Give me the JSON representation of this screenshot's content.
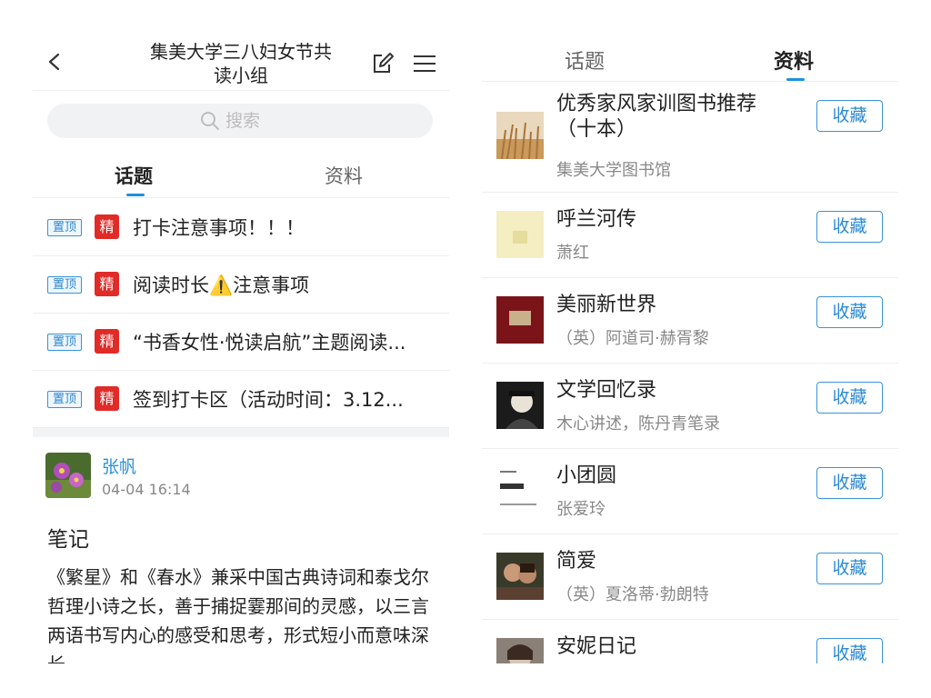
{
  "left": {
    "header": {
      "title": "集美大学三八妇女节共读小组"
    },
    "search": {
      "placeholder": "搜索"
    },
    "tabs": [
      {
        "label": "话题",
        "active": true
      },
      {
        "label": "资料",
        "active": false
      }
    ],
    "pinned": [
      {
        "badge": "置顶",
        "tag": "精",
        "title": "打卡注意事项！！！"
      },
      {
        "badge": "置顶",
        "tag": "精",
        "title": "阅读时长⚠️注意事项"
      },
      {
        "badge": "置顶",
        "tag": "精",
        "title": "“书香女性·悦读启航”主题阅读..."
      },
      {
        "badge": "置顶",
        "tag": "精",
        "title": "签到打卡区（活动时间：3.12..."
      }
    ],
    "post": {
      "author": "张帆",
      "time": "04-04 16:14",
      "title": "笔记",
      "body": "《繁星》和《春水》兼采中国古典诗词和泰戈尔哲理小诗之长，善于捕捉霎那间的灵感，以三言两语书写内心的感受和思考，形式短小而意味深长。"
    }
  },
  "right": {
    "tabs": [
      {
        "label": "话题",
        "active": false
      },
      {
        "label": "资料",
        "active": true
      }
    ],
    "books": [
      {
        "title": "优秀家风家训图书推荐（十本）",
        "author": "集美大学图书馆",
        "button": "收藏",
        "cover": "wheat-field"
      },
      {
        "title": "呼兰河传",
        "author": "萧红",
        "button": "收藏",
        "cover": "plain-yellow"
      },
      {
        "title": "美丽新世界",
        "author": "（英）阿道司·赫胥黎",
        "button": "收藏",
        "cover": "dark-red"
      },
      {
        "title": "文学回忆录",
        "author": "木心讲述，陈丹青笔录",
        "button": "收藏",
        "cover": "portrait-bw"
      },
      {
        "title": "小团圆",
        "author": "张爱玲",
        "button": "收藏",
        "cover": "white-text"
      },
      {
        "title": "简爱",
        "author": "（英）夏洛蒂·勃朗特",
        "button": "收藏",
        "cover": "film-still"
      },
      {
        "title": "安妮日记",
        "author": "",
        "button": "收藏",
        "cover": "photo-girl"
      }
    ]
  },
  "colors": {
    "accent": "#1e8fe1",
    "badge_red": "#e02b27",
    "link_blue": "#2a91d8"
  }
}
